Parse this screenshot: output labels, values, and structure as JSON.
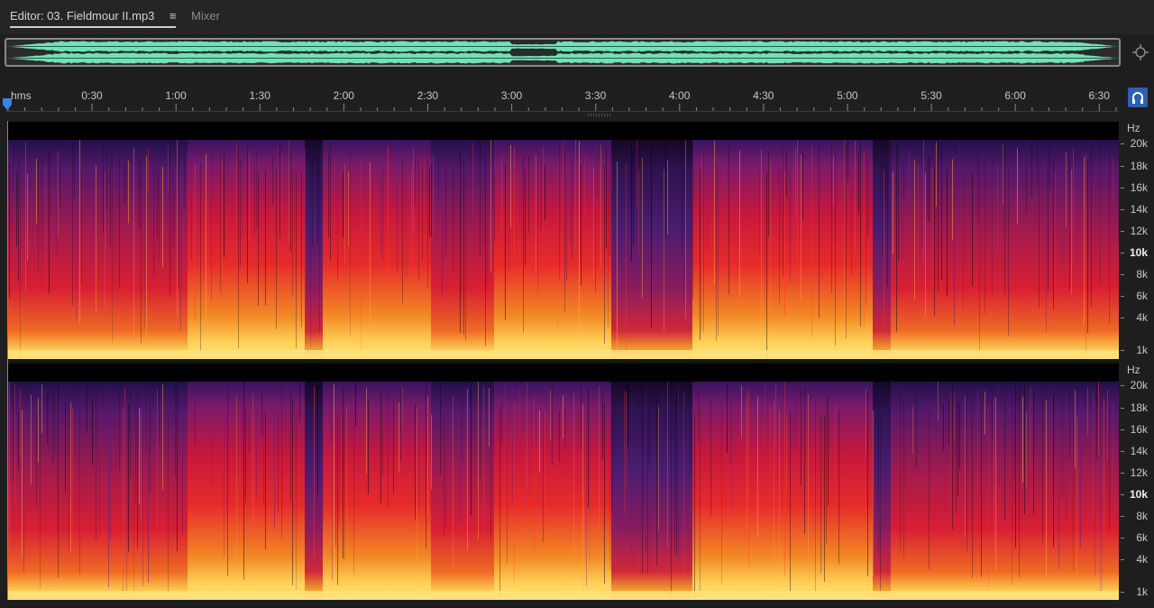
{
  "tabs": {
    "editor_label": "Editor: 03. Fieldmour II.mp3",
    "menu_icon": "hamburger-menu-icon",
    "mixer_label": "Mixer"
  },
  "ruler": {
    "unit": "hms",
    "ticks": [
      "0:30",
      "1:00",
      "1:30",
      "2:00",
      "2:30",
      "3:00",
      "3:30",
      "4:00",
      "4:30",
      "5:00",
      "5:30",
      "6:00",
      "6:30"
    ]
  },
  "freq_scale": {
    "unit": "Hz",
    "labels": [
      "20k",
      "18k",
      "16k",
      "14k",
      "12k",
      "10k",
      "8k",
      "6k",
      "4k",
      "1k"
    ],
    "bold_label": "10k"
  },
  "icons": {
    "zoom": "zoom-navigator-icon",
    "monitor": "headphones-icon",
    "playhead": "playhead-marker-icon"
  },
  "colors": {
    "waveform": "#6fe3b4",
    "accent_blue": "#2f5fb0",
    "spectral_low": "#ffe27a",
    "spectral_mid": "#e01d3a",
    "spectral_high": "#4a1c70"
  }
}
